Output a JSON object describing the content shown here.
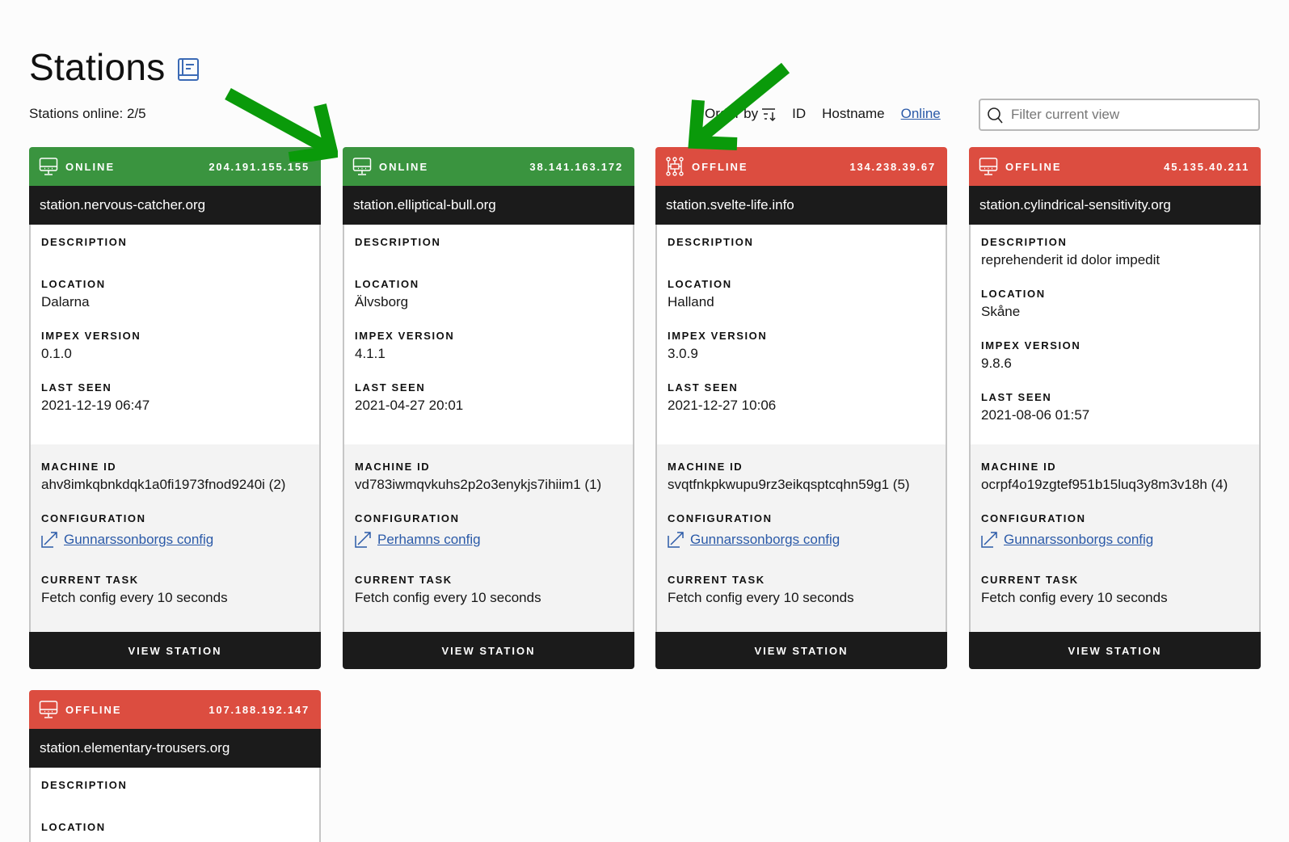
{
  "header": {
    "title": "Stations",
    "docs_icon": "book-icon",
    "online_summary": "Stations online: 2/5"
  },
  "order_by": {
    "label": "Order by",
    "sort_icon": "sort-descending-icon",
    "options": [
      "ID",
      "Hostname",
      "Online"
    ],
    "active": "Online"
  },
  "filter": {
    "placeholder": "Filter current view",
    "value": "",
    "icon": "search-icon"
  },
  "labels": {
    "description": "DESCRIPTION",
    "location": "LOCATION",
    "impex_version": "IMPEX VERSION",
    "last_seen": "LAST SEEN",
    "machine_id": "MACHINE ID",
    "configuration": "CONFIGURATION",
    "current_task": "CURRENT TASK",
    "view_station": "VIEW STATION"
  },
  "colors": {
    "online": "#3a943f",
    "offline": "#dc4d40",
    "dark": "#1b1b1b",
    "link": "#2b5aa8",
    "annotation_arrow": "#0a9a0a"
  },
  "stations": [
    {
      "status": "ONLINE",
      "status_icon": "desktop-icon",
      "ip": "204.191.155.155",
      "hostname": "station.nervous-catcher.org",
      "description": "",
      "location": "Dalarna",
      "impex_version": "0.1.0",
      "last_seen": "2021-12-19 06:47",
      "machine_id": "ahv8imkqbnkdqk1a0fi1973fnod9240i (2)",
      "configuration": "Gunnarssonborgs config",
      "current_task": "Fetch config every 10 seconds"
    },
    {
      "status": "ONLINE",
      "status_icon": "desktop-icon",
      "ip": "38.141.163.172",
      "hostname": "station.elliptical-bull.org",
      "description": "",
      "location": "Älvsborg",
      "impex_version": "4.1.1",
      "last_seen": "2021-04-27 20:01",
      "machine_id": "vd783iwmqvkuhs2p2o3enykjs7ihiim1 (1)",
      "configuration": "Perhamns config",
      "current_task": "Fetch config every 10 seconds"
    },
    {
      "status": "OFFLINE",
      "status_icon": "network-icon",
      "ip": "134.238.39.67",
      "hostname": "station.svelte-life.info",
      "description": "",
      "location": "Halland",
      "impex_version": "3.0.9",
      "last_seen": "2021-12-27 10:06",
      "machine_id": "svqtfnkpkwupu9rz3eikqsptcqhn59g1 (5)",
      "configuration": "Gunnarssonborgs config",
      "current_task": "Fetch config every 10 seconds"
    },
    {
      "status": "OFFLINE",
      "status_icon": "desktop-icon",
      "ip": "45.135.40.211",
      "hostname": "station.cylindrical-sensitivity.org",
      "description": "reprehenderit id dolor impedit",
      "location": "Skåne",
      "impex_version": "9.8.6",
      "last_seen": "2021-08-06 01:57",
      "machine_id": "ocrpf4o19zgtef951b15luq3y8m3v18h (4)",
      "configuration": "Gunnarssonborgs config",
      "current_task": "Fetch config every 10 seconds"
    },
    {
      "status": "OFFLINE",
      "status_icon": "desktop-icon",
      "ip": "107.188.192.147",
      "hostname": "station.elementary-trousers.org",
      "description": "",
      "location": ""
    }
  ]
}
